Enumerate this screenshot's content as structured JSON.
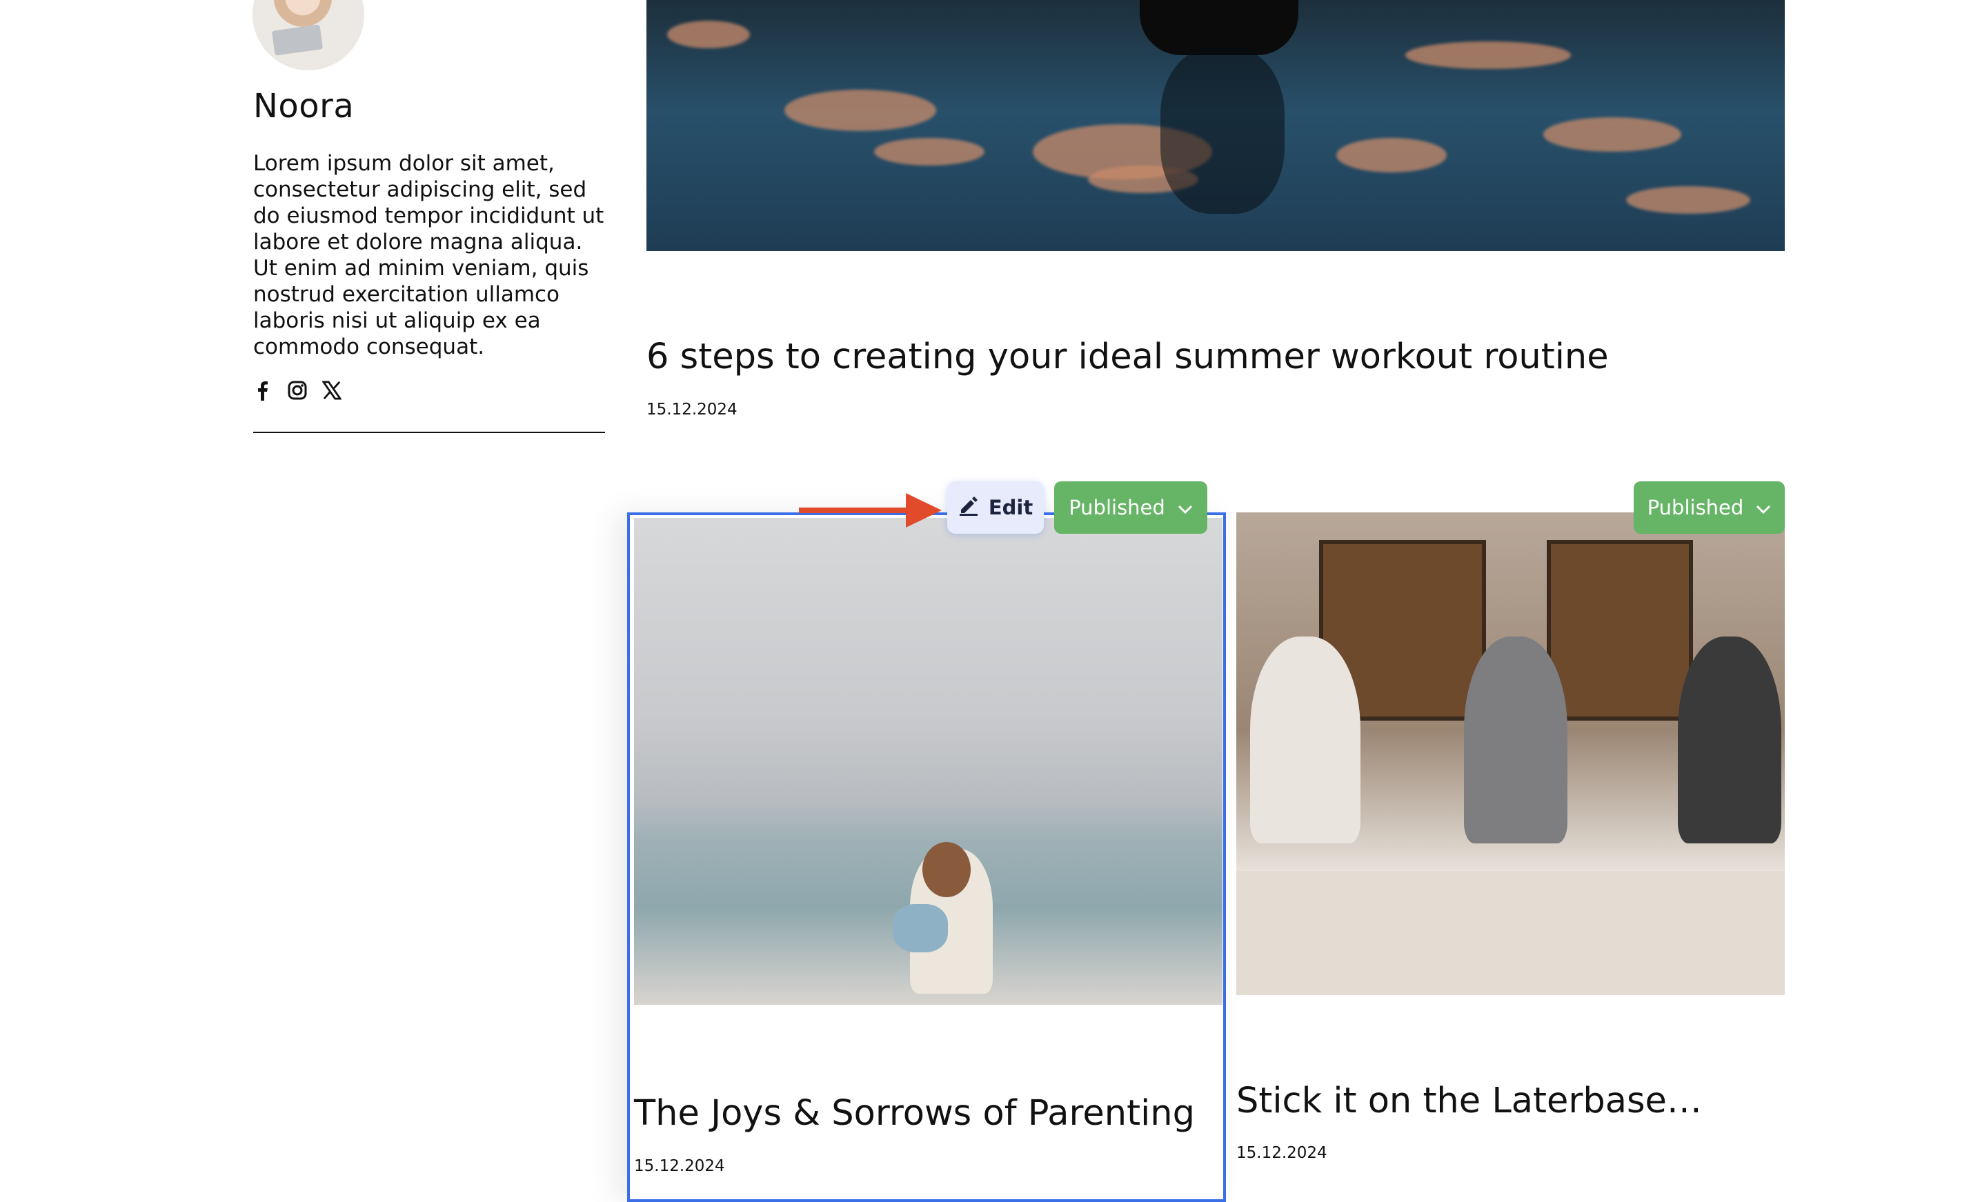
{
  "sidebar": {
    "author_name": "Noora",
    "bio": "Lorem ipsum dolor sit amet, consectetur adipiscing elit, sed do eiusmod tempor incididunt ut labore et dolore magna aliqua. Ut enim ad minim veniam, quis nostrud exercitation ullamco laboris nisi ut aliquip ex ea commodo consequat.",
    "socials": [
      "facebook-icon",
      "instagram-icon",
      "x-icon"
    ]
  },
  "posts": [
    {
      "title": "6 steps to creating your ideal summer workout routine",
      "date": "15.12.2024"
    },
    {
      "title": "The Joys & Sorrows of Parenting",
      "date": "15.12.2024",
      "status": "Published",
      "edit_label": "Edit"
    },
    {
      "title": "Stick it on the Laterbase…",
      "date": "15.12.2024",
      "status": "Published"
    }
  ],
  "colors": {
    "selection_outline": "#3a6fe8",
    "published_badge": "#66b466",
    "edit_button_bg": "#e7ebfb",
    "arrow": "#e14a2b"
  }
}
